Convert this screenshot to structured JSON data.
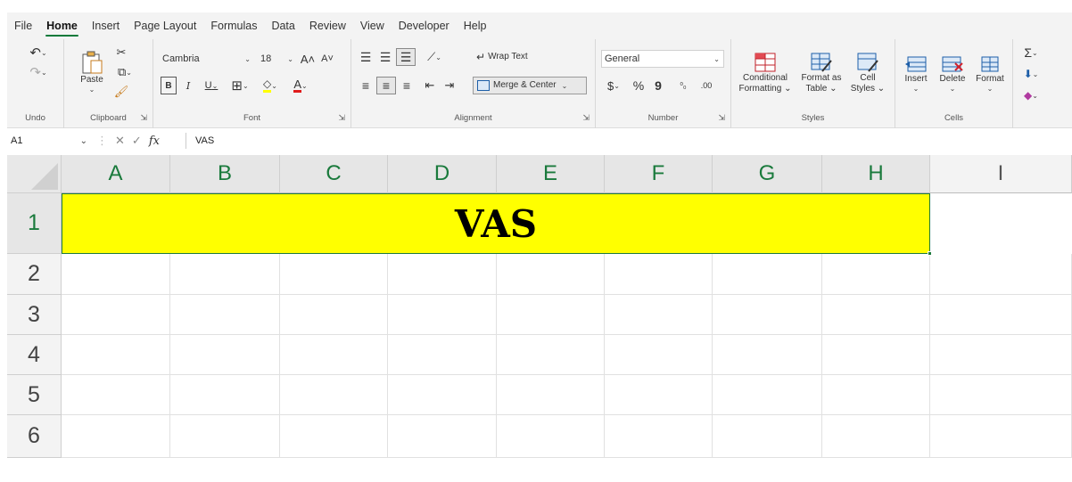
{
  "menu": {
    "tabs": [
      "File",
      "Home",
      "Insert",
      "Page Layout",
      "Formulas",
      "Data",
      "Review",
      "View",
      "Developer",
      "Help"
    ],
    "active_index": 1
  },
  "ribbon": {
    "undo": {
      "group": "Undo"
    },
    "clipboard": {
      "paste": "Paste",
      "group": "Clipboard"
    },
    "font": {
      "name": "Cambria",
      "size": "18",
      "group": "Font",
      "bold": "B",
      "italic": "I",
      "underline": "U",
      "grow": "A˄",
      "shrink": "A˅",
      "font_color_letter": "A"
    },
    "alignment": {
      "wrap_text": "Wrap Text",
      "merge_center": "Merge & Center",
      "group": "Alignment"
    },
    "number": {
      "format": "General",
      "currency": "$",
      "percent": "%",
      "comma": "9",
      "inc_dec": "⁰₀",
      "dec_dec": ".00",
      "group": "Number"
    },
    "styles": {
      "conditional_line1": "Conditional",
      "conditional_line2": "Formatting",
      "format_table_line1": "Format as",
      "format_table_line2": "Table",
      "cell_styles_line1": "Cell",
      "cell_styles_line2": "Styles",
      "group": "Styles"
    },
    "cells": {
      "insert": "Insert",
      "delete": "Delete",
      "format": "Format",
      "group": "Cells"
    },
    "editing": {
      "sum": "Σ"
    }
  },
  "formula_bar": {
    "name_box": "A1",
    "fx": "fx",
    "value": "VAS"
  },
  "sheet": {
    "columns": [
      "A",
      "B",
      "C",
      "D",
      "E",
      "F",
      "G",
      "H",
      "I"
    ],
    "rows": [
      "1",
      "2",
      "3",
      "4",
      "5",
      "6"
    ],
    "merged_text": "VAS",
    "merged_fill": "#ffff00",
    "selection_color": "#1e7a3c"
  }
}
